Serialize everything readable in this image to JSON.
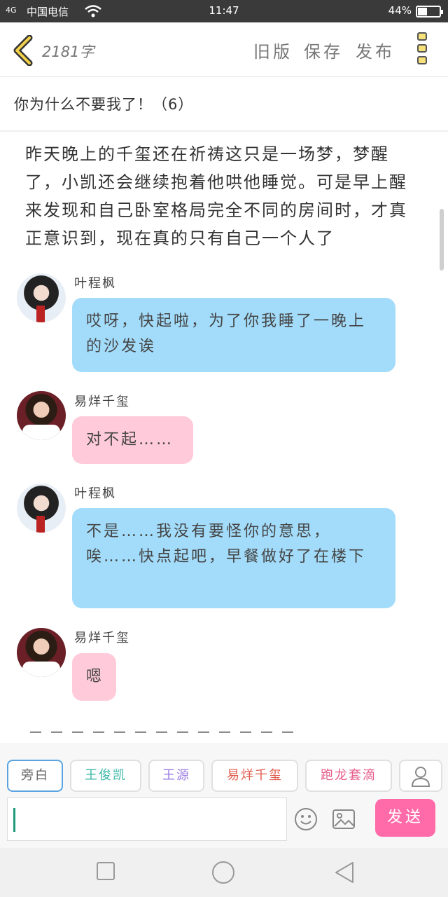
{
  "status": {
    "signal": "4G",
    "carrier": "中国电信",
    "time": "11:47",
    "battery_text": "44%",
    "battery_level": 0.44
  },
  "nav": {
    "word_count": "2181字",
    "old_version": "旧版",
    "save": "保存",
    "publish": "发布"
  },
  "title": "你为什么不要我了！（6）",
  "paragraph": "昨天晚上的千玺还在祈祷这只是一场梦，梦醒了，小凯还会继续抱着他哄他睡觉。可是早上醒来发现和自己卧室格局完全不同的房间时，才真正意识到，现在真的只有自己一个人了",
  "messages": [
    {
      "speaker": "叶程枫",
      "text": "哎呀，快起啦，为了你我睡了一晚上的沙发诶"
    },
    {
      "speaker": "易烊千玺",
      "text": "对不起……"
    },
    {
      "speaker": "叶程枫",
      "text": "不是……我没有要怪你的意思，唉……快点起吧，早餐做好了在楼下"
    },
    {
      "speaker": "易烊千玺",
      "text": "嗯"
    }
  ],
  "separator": "－－－－－－－－－－－－－",
  "toolbar": {
    "chips": [
      "旁白",
      "王俊凯",
      "王源",
      "易烊千玺",
      "跑龙套滴"
    ],
    "input_value": "",
    "send": "发送"
  },
  "colors": {
    "blue_bubble": "#a3dcfa",
    "pink_bubble": "#ffcbdb",
    "send_button": "#ff6aa8"
  }
}
